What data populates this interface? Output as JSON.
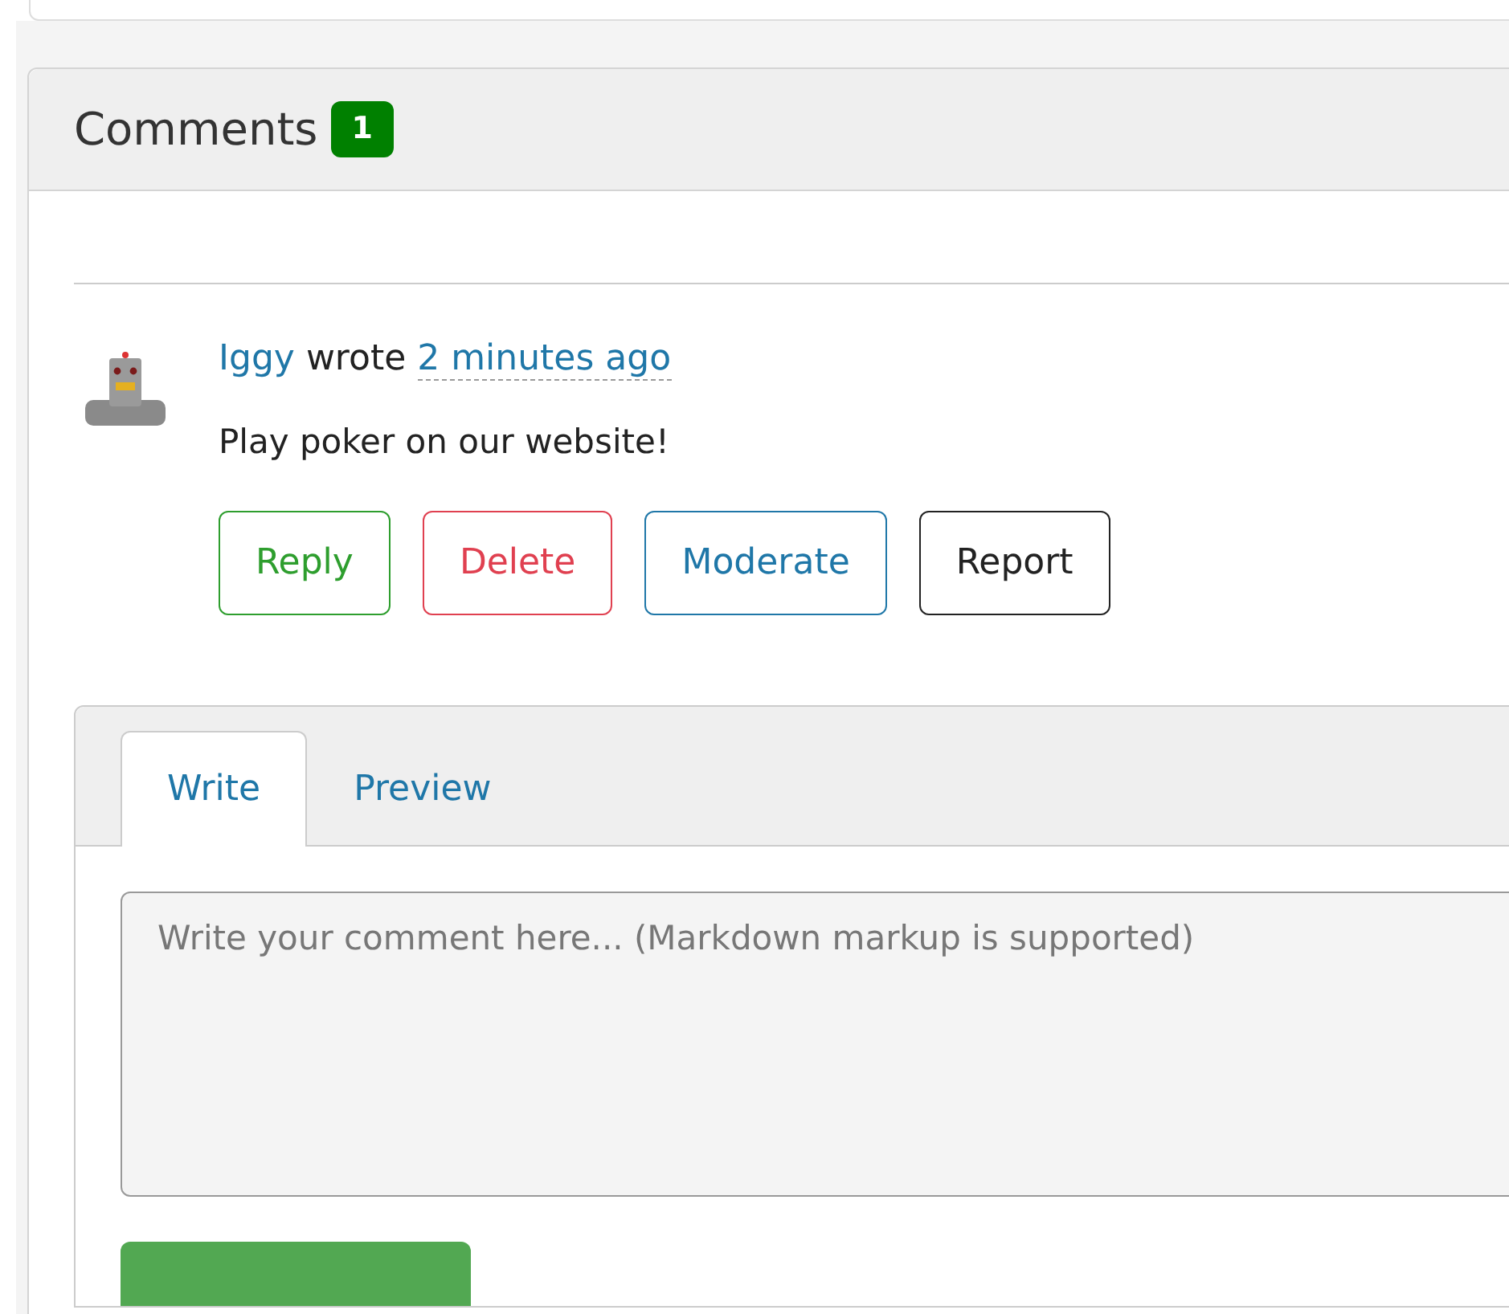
{
  "comments_panel": {
    "title": "Comments",
    "count": "1"
  },
  "comments": [
    {
      "author": "Iggy",
      "verb": "wrote",
      "time": "2 minutes ago",
      "body": "Play poker on our website!",
      "actions": [
        {
          "label": "Reply",
          "kind": "success"
        },
        {
          "label": "Delete",
          "kind": "danger"
        },
        {
          "label": "Moderate",
          "kind": "primary"
        },
        {
          "label": "Report",
          "kind": "default"
        }
      ]
    }
  ],
  "editor": {
    "tabs": [
      {
        "label": "Write",
        "selected": true
      },
      {
        "label": "Preview",
        "selected": false
      }
    ],
    "placeholder": "Write your comment here... (Markdown markup is supported)"
  }
}
